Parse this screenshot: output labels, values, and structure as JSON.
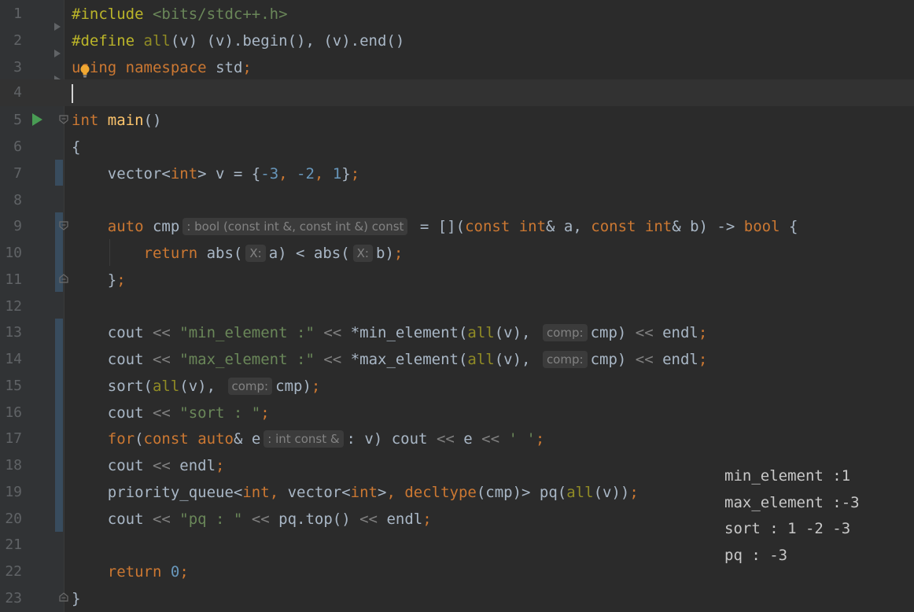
{
  "gutter": {
    "line_numbers": [
      "1",
      "2",
      "3",
      "4",
      "5",
      "6",
      "7",
      "8",
      "9",
      "10",
      "11",
      "12",
      "13",
      "14",
      "15",
      "16",
      "17",
      "18",
      "19",
      "20",
      "21",
      "22",
      "23"
    ]
  },
  "code": {
    "l1": {
      "directive": "#include",
      "header": "<bits/stdc++.h>"
    },
    "l2": {
      "directive": "#define",
      "macro": "all",
      "params": "(v) (v).begin(), (v).end()"
    },
    "l3": {
      "kw1": "using",
      "kw2": "namespace",
      "name": "std",
      "semi": ";"
    },
    "l5": {
      "type": "int",
      "name": "main",
      "parens": "()"
    },
    "l6": {
      "brace": "{"
    },
    "l7": {
      "text1": "    vector<",
      "type": "int",
      "text2": "> v = {",
      "n1": "-3",
      "n2": "-2",
      "n3": "1",
      "text3": "};"
    },
    "l9": {
      "kw": "auto",
      "name": "cmp",
      "hint": ": bool (const int &, const int &) const",
      "a": "const",
      "b": "int",
      "c": "& a, ",
      "d": "const",
      "e": "int",
      "f": "& b) -> ",
      "g": "bool",
      "h": " {"
    },
    "l10": {
      "kw": "return",
      "hint": "X:"
    },
    "l11": {
      "text": "};"
    },
    "l13": {
      "str": "\"min_element :\"",
      "fn": "*min_element(",
      "macro": "all",
      "hint": "comp:"
    },
    "l14": {
      "str": "\"max_element :\"",
      "fn": "*max_element(",
      "macro": "all",
      "hint": "comp:"
    },
    "l15": {
      "fn": "sort(",
      "macro": "all",
      "hint": "comp:"
    },
    "l16": {
      "str": "\"sort : \""
    },
    "l17": {
      "kw1": "for",
      "kw2": "const",
      "kw3": "auto",
      "hint": ": int const &",
      "chr": "' '"
    },
    "l19": {
      "fn": "priority_queue<",
      "t1": "int",
      "t2": "vector<",
      "t3": "int",
      "kw": "decltype",
      "macro": "all"
    },
    "l20": {
      "str": "\"pq : \""
    },
    "l22": {
      "kw": "return",
      "num": "0"
    },
    "l23": {
      "brace": "}"
    }
  },
  "output": {
    "lines": [
      "min_element :1",
      "max_element :-3",
      "sort : 1 -2 -3",
      "pq : -3"
    ]
  }
}
